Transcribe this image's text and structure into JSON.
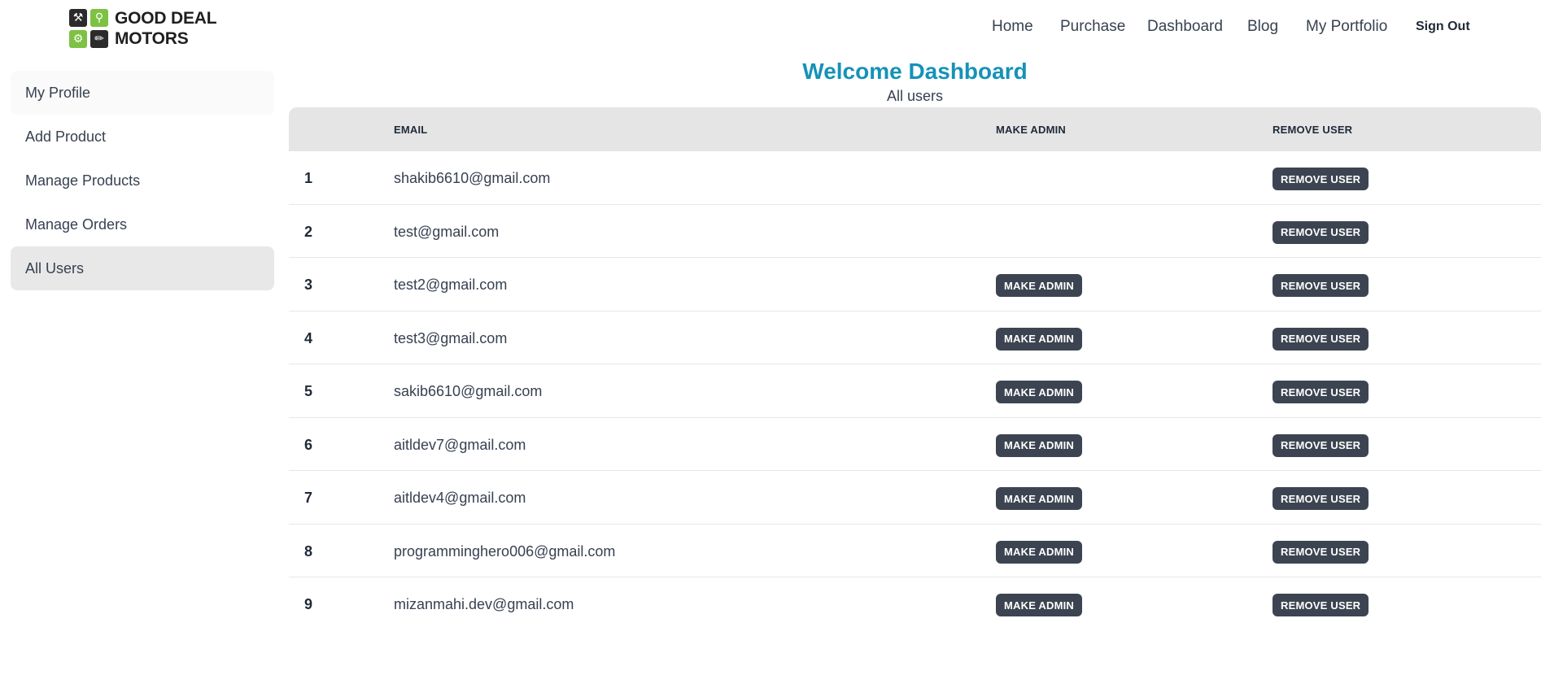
{
  "brand": {
    "line1": "GOOD DEAL",
    "line2": "MOTORS",
    "icons": [
      "tools-icon",
      "wrench-icon",
      "gear-icon",
      "screwdriver-icon"
    ]
  },
  "nav": {
    "home": "Home",
    "purchase": "Purchase",
    "dashboard": "Dashboard",
    "blog": "Blog",
    "portfolio": "My Portfolio",
    "signout": "Sign Out"
  },
  "sidebar": {
    "items": [
      {
        "label": "My Profile"
      },
      {
        "label": "Add Product"
      },
      {
        "label": "Manage Products"
      },
      {
        "label": "Manage Orders"
      },
      {
        "label": "All Users"
      }
    ],
    "active": "All Users"
  },
  "main": {
    "title": "Welcome Dashboard",
    "subtitle": "All users"
  },
  "table": {
    "headers": {
      "num": "",
      "email": "EMAIL",
      "make_admin": "MAKE ADMIN",
      "remove_user": "REMOVE USER"
    },
    "make_admin_label": "MAKE ADMIN",
    "remove_user_label": "REMOVE USER",
    "rows": [
      {
        "num": "1",
        "email": "shakib6610@gmail.com",
        "show_make_admin": false
      },
      {
        "num": "2",
        "email": "test@gmail.com",
        "show_make_admin": false
      },
      {
        "num": "3",
        "email": "test2@gmail.com",
        "show_make_admin": true
      },
      {
        "num": "4",
        "email": "test3@gmail.com",
        "show_make_admin": true
      },
      {
        "num": "5",
        "email": "sakib6610@gmail.com",
        "show_make_admin": true
      },
      {
        "num": "6",
        "email": "aitldev7@gmail.com",
        "show_make_admin": true
      },
      {
        "num": "7",
        "email": "aitldev4@gmail.com",
        "show_make_admin": true
      },
      {
        "num": "8",
        "email": "programminghero006@gmail.com",
        "show_make_admin": true
      },
      {
        "num": "9",
        "email": "mizanmahi.dev@gmail.com",
        "show_make_admin": true
      }
    ]
  },
  "colors": {
    "title": "#1592b8",
    "button": "#3d4451",
    "logo_green": "#7dc243",
    "logo_dark": "#2b2b2b",
    "header_bg": "#e5e5e5",
    "active_sidebar": "#e8e8e8"
  }
}
